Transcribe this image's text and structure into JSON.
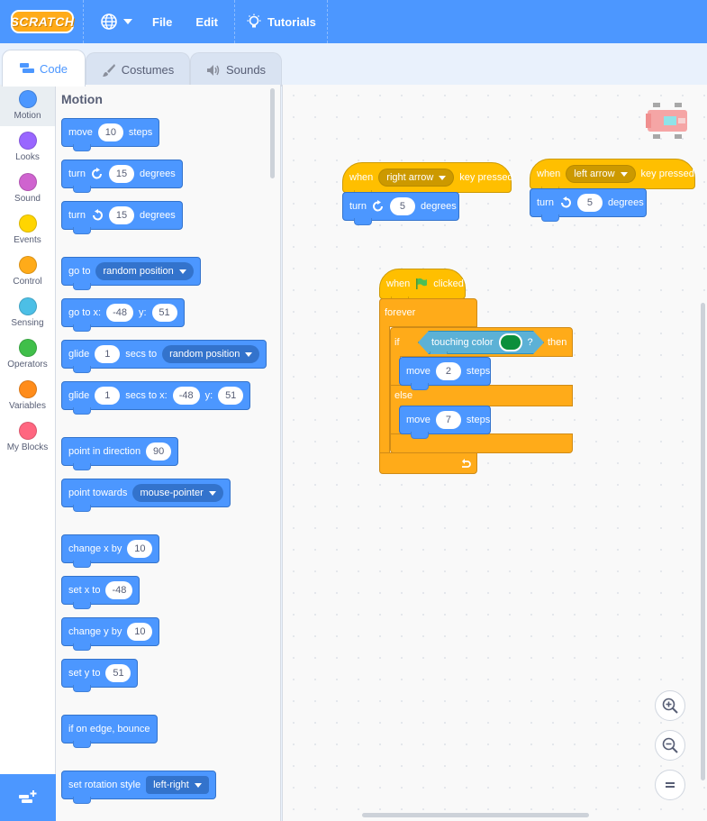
{
  "menu": {
    "logo": "SCRATCH",
    "file": "File",
    "edit": "Edit",
    "tutorials": "Tutorials"
  },
  "tabs": {
    "code": "Code",
    "costumes": "Costumes",
    "sounds": "Sounds"
  },
  "categories": [
    {
      "label": "Motion",
      "color": "#4c97ff"
    },
    {
      "label": "Looks",
      "color": "#9966ff"
    },
    {
      "label": "Sound",
      "color": "#cf63cf"
    },
    {
      "label": "Events",
      "color": "#ffd500"
    },
    {
      "label": "Control",
      "color": "#ffab19"
    },
    {
      "label": "Sensing",
      "color": "#4cbfe6"
    },
    {
      "label": "Operators",
      "color": "#40bf4a"
    },
    {
      "label": "Variables",
      "color": "#ff8c1a"
    },
    {
      "label": "My Blocks",
      "color": "#ff6680"
    }
  ],
  "palette": {
    "title": "Motion",
    "move": {
      "label": "move",
      "value": "10",
      "suffix": "steps"
    },
    "turn_cw": {
      "label": "turn",
      "value": "15",
      "suffix": "degrees"
    },
    "turn_ccw": {
      "label": "turn",
      "value": "15",
      "suffix": "degrees"
    },
    "goto": {
      "label": "go to",
      "option": "random position"
    },
    "goto_xy": {
      "label": "go to x:",
      "x": "-48",
      "ylabel": "y:",
      "y": "51"
    },
    "glide_to": {
      "label": "glide",
      "secs": "1",
      "mid": "secs to",
      "option": "random position"
    },
    "glide_xy": {
      "label": "glide",
      "secs": "1",
      "mid": "secs to x:",
      "x": "-48",
      "ylabel": "y:",
      "y": "51"
    },
    "point_dir": {
      "label": "point in direction",
      "value": "90"
    },
    "point_towards": {
      "label": "point towards",
      "option": "mouse-pointer"
    },
    "change_x": {
      "label": "change x by",
      "value": "10"
    },
    "set_x": {
      "label": "set x to",
      "value": "-48"
    },
    "change_y": {
      "label": "change y by",
      "value": "10"
    },
    "set_y": {
      "label": "set y to",
      "value": "51"
    },
    "bounce": {
      "label": "if on edge, bounce"
    },
    "rotation": {
      "label": "set rotation style",
      "option": "left-right"
    }
  },
  "scripts": {
    "right": {
      "when": "when",
      "key": "right arrow",
      "pressed": "key pressed",
      "turn": "turn",
      "value": "5",
      "degrees": "degrees"
    },
    "left": {
      "when": "when",
      "key": "left arrow",
      "pressed": "key pressed",
      "turn": "turn",
      "value": "5",
      "degrees": "degrees"
    },
    "flag": {
      "when": "when",
      "clicked": "clicked",
      "forever": "forever",
      "if": "if",
      "touching": "touching color",
      "q": "?",
      "then": "then",
      "move1": "move",
      "move1_val": "2",
      "steps1": "steps",
      "else": "else",
      "move2": "move",
      "move2_val": "7",
      "steps2": "steps",
      "touch_color": "#0b8f3b"
    }
  },
  "zoom": {
    "in": "+",
    "out": "−",
    "reset": "="
  }
}
